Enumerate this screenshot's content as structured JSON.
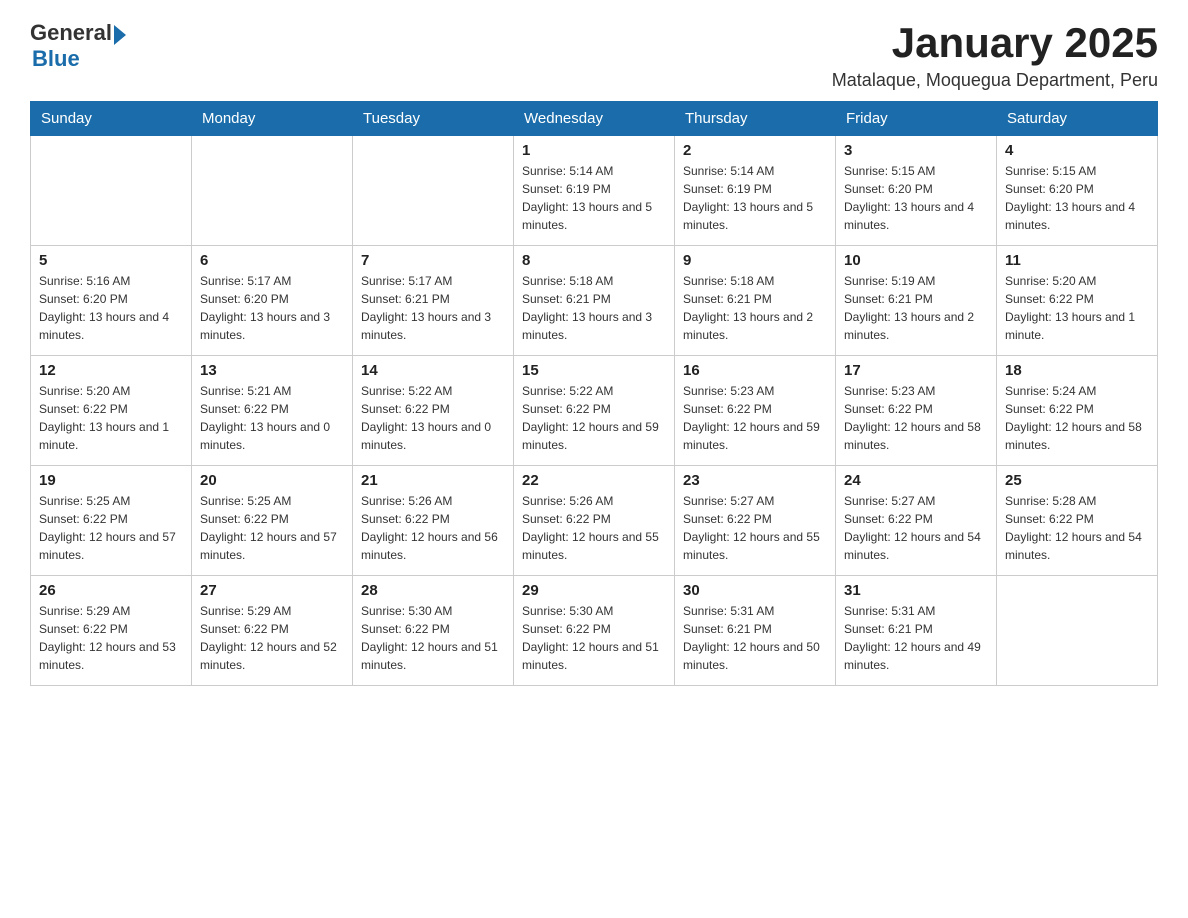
{
  "header": {
    "logo": {
      "general": "General",
      "blue": "Blue"
    },
    "month_title": "January 2025",
    "subtitle": "Matalaque, Moquegua Department, Peru"
  },
  "days_of_week": [
    "Sunday",
    "Monday",
    "Tuesday",
    "Wednesday",
    "Thursday",
    "Friday",
    "Saturday"
  ],
  "weeks": [
    {
      "days": [
        {
          "number": "",
          "info": ""
        },
        {
          "number": "",
          "info": ""
        },
        {
          "number": "",
          "info": ""
        },
        {
          "number": "1",
          "sunrise": "Sunrise: 5:14 AM",
          "sunset": "Sunset: 6:19 PM",
          "daylight": "Daylight: 13 hours and 5 minutes."
        },
        {
          "number": "2",
          "sunrise": "Sunrise: 5:14 AM",
          "sunset": "Sunset: 6:19 PM",
          "daylight": "Daylight: 13 hours and 5 minutes."
        },
        {
          "number": "3",
          "sunrise": "Sunrise: 5:15 AM",
          "sunset": "Sunset: 6:20 PM",
          "daylight": "Daylight: 13 hours and 4 minutes."
        },
        {
          "number": "4",
          "sunrise": "Sunrise: 5:15 AM",
          "sunset": "Sunset: 6:20 PM",
          "daylight": "Daylight: 13 hours and 4 minutes."
        }
      ]
    },
    {
      "days": [
        {
          "number": "5",
          "sunrise": "Sunrise: 5:16 AM",
          "sunset": "Sunset: 6:20 PM",
          "daylight": "Daylight: 13 hours and 4 minutes."
        },
        {
          "number": "6",
          "sunrise": "Sunrise: 5:17 AM",
          "sunset": "Sunset: 6:20 PM",
          "daylight": "Daylight: 13 hours and 3 minutes."
        },
        {
          "number": "7",
          "sunrise": "Sunrise: 5:17 AM",
          "sunset": "Sunset: 6:21 PM",
          "daylight": "Daylight: 13 hours and 3 minutes."
        },
        {
          "number": "8",
          "sunrise": "Sunrise: 5:18 AM",
          "sunset": "Sunset: 6:21 PM",
          "daylight": "Daylight: 13 hours and 3 minutes."
        },
        {
          "number": "9",
          "sunrise": "Sunrise: 5:18 AM",
          "sunset": "Sunset: 6:21 PM",
          "daylight": "Daylight: 13 hours and 2 minutes."
        },
        {
          "number": "10",
          "sunrise": "Sunrise: 5:19 AM",
          "sunset": "Sunset: 6:21 PM",
          "daylight": "Daylight: 13 hours and 2 minutes."
        },
        {
          "number": "11",
          "sunrise": "Sunrise: 5:20 AM",
          "sunset": "Sunset: 6:22 PM",
          "daylight": "Daylight: 13 hours and 1 minute."
        }
      ]
    },
    {
      "days": [
        {
          "number": "12",
          "sunrise": "Sunrise: 5:20 AM",
          "sunset": "Sunset: 6:22 PM",
          "daylight": "Daylight: 13 hours and 1 minute."
        },
        {
          "number": "13",
          "sunrise": "Sunrise: 5:21 AM",
          "sunset": "Sunset: 6:22 PM",
          "daylight": "Daylight: 13 hours and 0 minutes."
        },
        {
          "number": "14",
          "sunrise": "Sunrise: 5:22 AM",
          "sunset": "Sunset: 6:22 PM",
          "daylight": "Daylight: 13 hours and 0 minutes."
        },
        {
          "number": "15",
          "sunrise": "Sunrise: 5:22 AM",
          "sunset": "Sunset: 6:22 PM",
          "daylight": "Daylight: 12 hours and 59 minutes."
        },
        {
          "number": "16",
          "sunrise": "Sunrise: 5:23 AM",
          "sunset": "Sunset: 6:22 PM",
          "daylight": "Daylight: 12 hours and 59 minutes."
        },
        {
          "number": "17",
          "sunrise": "Sunrise: 5:23 AM",
          "sunset": "Sunset: 6:22 PM",
          "daylight": "Daylight: 12 hours and 58 minutes."
        },
        {
          "number": "18",
          "sunrise": "Sunrise: 5:24 AM",
          "sunset": "Sunset: 6:22 PM",
          "daylight": "Daylight: 12 hours and 58 minutes."
        }
      ]
    },
    {
      "days": [
        {
          "number": "19",
          "sunrise": "Sunrise: 5:25 AM",
          "sunset": "Sunset: 6:22 PM",
          "daylight": "Daylight: 12 hours and 57 minutes."
        },
        {
          "number": "20",
          "sunrise": "Sunrise: 5:25 AM",
          "sunset": "Sunset: 6:22 PM",
          "daylight": "Daylight: 12 hours and 57 minutes."
        },
        {
          "number": "21",
          "sunrise": "Sunrise: 5:26 AM",
          "sunset": "Sunset: 6:22 PM",
          "daylight": "Daylight: 12 hours and 56 minutes."
        },
        {
          "number": "22",
          "sunrise": "Sunrise: 5:26 AM",
          "sunset": "Sunset: 6:22 PM",
          "daylight": "Daylight: 12 hours and 55 minutes."
        },
        {
          "number": "23",
          "sunrise": "Sunrise: 5:27 AM",
          "sunset": "Sunset: 6:22 PM",
          "daylight": "Daylight: 12 hours and 55 minutes."
        },
        {
          "number": "24",
          "sunrise": "Sunrise: 5:27 AM",
          "sunset": "Sunset: 6:22 PM",
          "daylight": "Daylight: 12 hours and 54 minutes."
        },
        {
          "number": "25",
          "sunrise": "Sunrise: 5:28 AM",
          "sunset": "Sunset: 6:22 PM",
          "daylight": "Daylight: 12 hours and 54 minutes."
        }
      ]
    },
    {
      "days": [
        {
          "number": "26",
          "sunrise": "Sunrise: 5:29 AM",
          "sunset": "Sunset: 6:22 PM",
          "daylight": "Daylight: 12 hours and 53 minutes."
        },
        {
          "number": "27",
          "sunrise": "Sunrise: 5:29 AM",
          "sunset": "Sunset: 6:22 PM",
          "daylight": "Daylight: 12 hours and 52 minutes."
        },
        {
          "number": "28",
          "sunrise": "Sunrise: 5:30 AM",
          "sunset": "Sunset: 6:22 PM",
          "daylight": "Daylight: 12 hours and 51 minutes."
        },
        {
          "number": "29",
          "sunrise": "Sunrise: 5:30 AM",
          "sunset": "Sunset: 6:22 PM",
          "daylight": "Daylight: 12 hours and 51 minutes."
        },
        {
          "number": "30",
          "sunrise": "Sunrise: 5:31 AM",
          "sunset": "Sunset: 6:21 PM",
          "daylight": "Daylight: 12 hours and 50 minutes."
        },
        {
          "number": "31",
          "sunrise": "Sunrise: 5:31 AM",
          "sunset": "Sunset: 6:21 PM",
          "daylight": "Daylight: 12 hours and 49 minutes."
        },
        {
          "number": "",
          "info": ""
        }
      ]
    }
  ]
}
